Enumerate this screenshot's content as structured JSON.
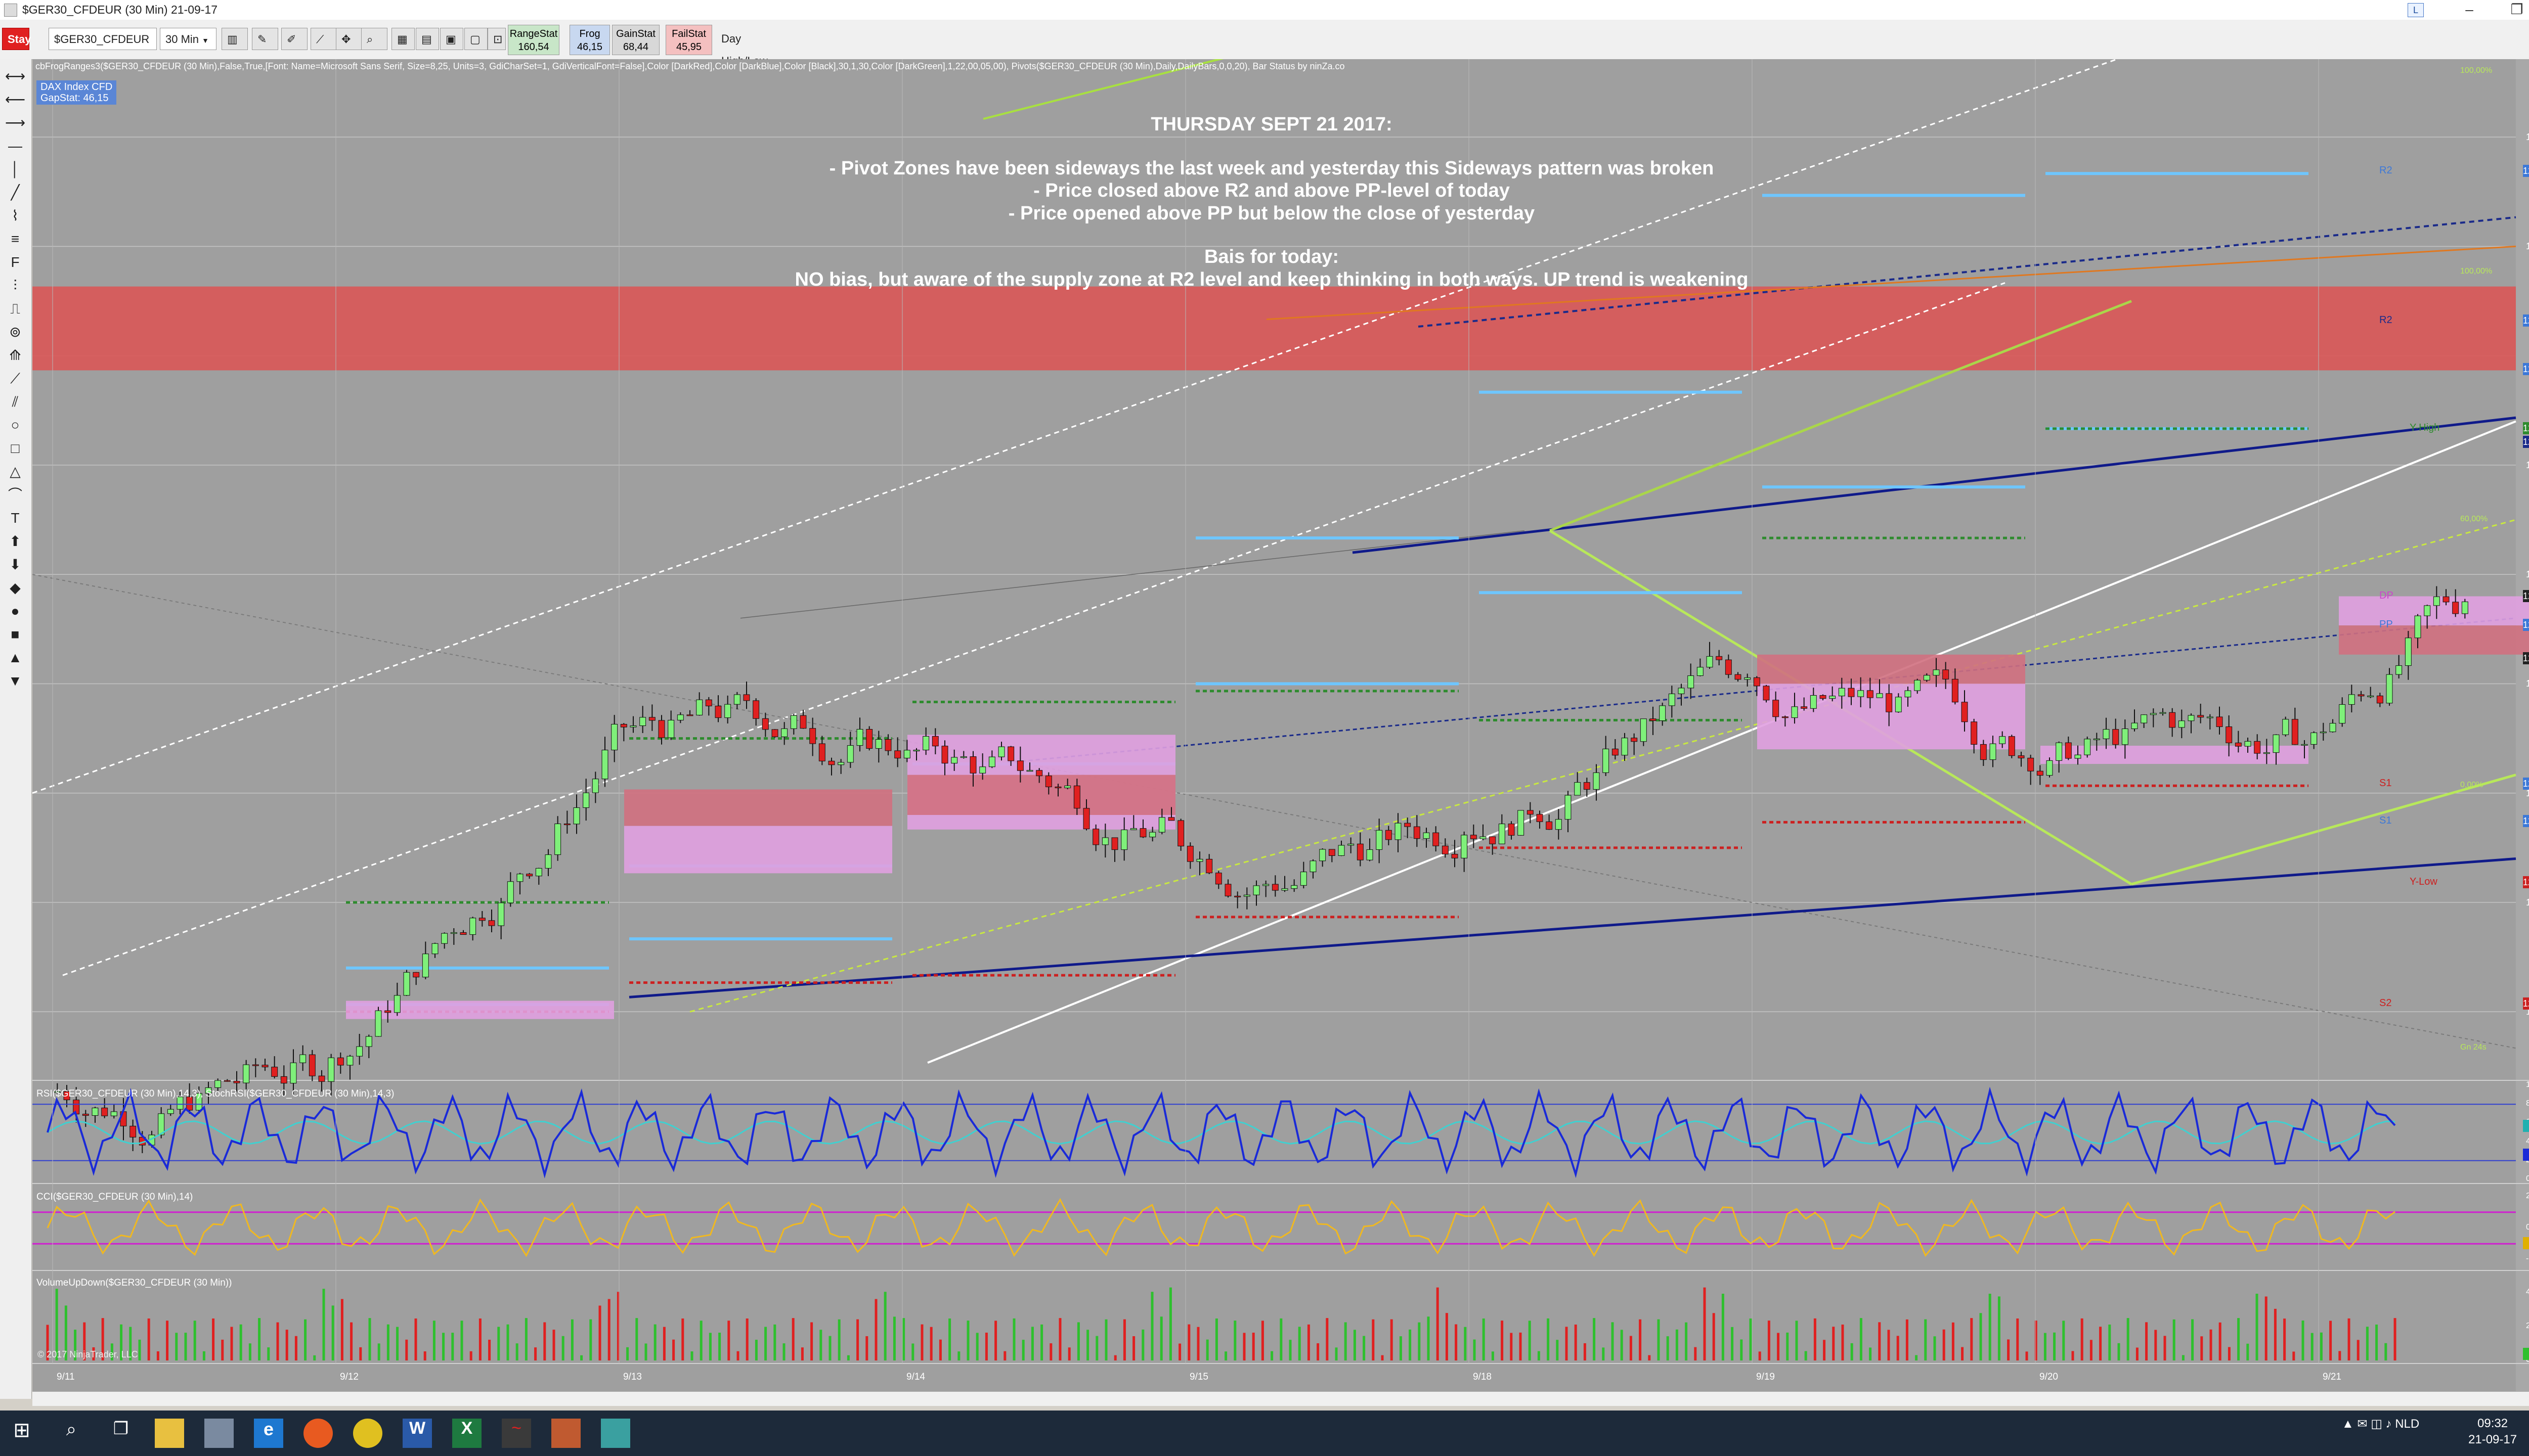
{
  "window": {
    "title": "$GER30_CFDEUR (30 Min)  21-09-17"
  },
  "toolbar": {
    "stay_label": "Stay",
    "instrument": "$GER30_CFDEUR",
    "interval": "30 Min",
    "stats": [
      {
        "name": "RangeStat",
        "value": "160,54",
        "bg": "#c8e6c8"
      },
      {
        "name": "Frog",
        "value": "46,15",
        "bg": "#c8d8f0"
      },
      {
        "name": "GainStat",
        "value": "68,44",
        "bg": "#d8d8d8"
      },
      {
        "name": "FailStat",
        "value": "45,95",
        "bg": "#f4c0c0"
      }
    ],
    "day_hl_label": "Day High/Low"
  },
  "chart": {
    "indicator_line": "cbFrogRanges3($GER30_CFDEUR (30 Min),False,True,[Font: Name=Microsoft Sans Serif, Size=8,25, Units=3, GdiCharSet=1, GdiVerticalFont=False],Color [DarkRed],Color [DarkBlue],Color [Black],30,1,30,Color [DarkGreen],1,22,00,05,00), Pivots($GER30_CFDEUR (30 Min),Daily,DailyBars,0,0,20), Bar Status by ninZa.co",
    "info_title": "DAX Index CFD",
    "info_gap": "GapStat: 46,15",
    "annotations": [
      "THURSDAY SEPT 21 2017:",
      "- Pivot Zones have been sideways the last week and yesterday this Sideways pattern was broken",
      "- Price closed above R2 and above PP-level of today",
      "- Price opened above PP but below the close of yesterday",
      "Bais for today:",
      "NO bias, but aware of the supply zone at R2 level and keep thinking in both ways. UP trend is weakening"
    ],
    "price_axis": [
      "12720,00",
      "12690,00",
      "12630,00",
      "12600,00",
      "12570,00",
      "12540,00",
      "12510,00",
      "12480,00"
    ],
    "price_tags": [
      {
        "text": "12710,72",
        "color": "#3c78d8",
        "price": 12710.72
      },
      {
        "text": "12669,65",
        "color": "#3c78d8",
        "price": 12669.65
      },
      {
        "text": "12656,38",
        "color": "#3c78d8",
        "price": 12656.38
      },
      {
        "text": "12640,06",
        "color": "#2e8b2e",
        "price": 12640.06
      },
      {
        "text": "12636,35",
        "color": "#1a2a8a",
        "price": 12636.35
      },
      {
        "text": "12594,05",
        "color": "#222222",
        "price": 12594.05
      },
      {
        "text": "12586,22",
        "color": "#3c78d8",
        "price": 12586.22
      },
      {
        "text": "12576,96",
        "color": "#222222",
        "price": 12576.96
      },
      {
        "text": "12542,56",
        "color": "#3c78d8",
        "price": 12542.56
      },
      {
        "text": "12532,38",
        "color": "#3c78d8",
        "price": 12532.38
      },
      {
        "text": "12515,55",
        "color": "#cc2020",
        "price": 12515.55
      },
      {
        "text": "12482,25",
        "color": "#cc2020",
        "price": 12482.25
      }
    ],
    "pivot_labels": [
      {
        "text": "R2",
        "price": 12710.72,
        "color": "#3c78d8"
      },
      {
        "text": "R2",
        "price": 12669.65,
        "color": "#1a2a8a"
      },
      {
        "text": "Y-High",
        "price": 12640.06,
        "color": "#2e8b2e"
      },
      {
        "text": "DP",
        "price": 12594.05,
        "color": "#cc44cc"
      },
      {
        "text": "PP",
        "price": 12586.22,
        "color": "#3c78d8"
      },
      {
        "text": "S1",
        "price": 12542.56,
        "color": "#cc2020"
      },
      {
        "text": "S1",
        "price": 12532.38,
        "color": "#3c78d8"
      },
      {
        "text": "Y-Low",
        "price": 12515.55,
        "color": "#cc2020"
      },
      {
        "text": "S2",
        "price": 12482.25,
        "color": "#cc2020"
      }
    ],
    "fib_labels": [
      {
        "text": "100,00%",
        "price": 12738
      },
      {
        "text": "100,00%",
        "price": 12683
      },
      {
        "text": "60,00%",
        "price": 12615
      },
      {
        "text": "0,00%",
        "price": 12542
      },
      {
        "text": "Gn 24s",
        "price": 12470
      }
    ],
    "dates": [
      "9/11",
      "9/12",
      "9/13",
      "9/14",
      "9/15",
      "9/18",
      "9/19",
      "9/20",
      "9/21"
    ],
    "copyright": "© 2017 NinjaTrader, LLC",
    "rsi_label": "RSI($GER30_CFDEUR (30 Min),14,3), StochRSI($GER30_CFDEUR (30 Min),14,3)",
    "rsi_axis": [
      "100",
      "80",
      "60",
      "40",
      "20",
      "0"
    ],
    "rsi_tags": [
      {
        "text": "56,89",
        "color": "#20b0b0"
      },
      {
        "text": "26,29",
        "color": "#1a2ad8"
      }
    ],
    "cci_label": "CCI($GER30_CFDEUR (30 Min),14)",
    "cci_axis": [
      "200",
      "0",
      "-200"
    ],
    "cci_tag": {
      "text": "-96,33",
      "color": "#e0b000"
    },
    "vol_label": "VolumeUpDown($GER30_CFDEUR (30 Min))",
    "vol_axis": [
      "4000",
      "2000",
      "0"
    ],
    "vol_tag": {
      "text": "137",
      "color": "#2ec02e"
    }
  },
  "chart_data": {
    "type": "candlestick",
    "ylim": [
      12462,
      12740
    ],
    "candles_per_day": 30,
    "days": [
      "9/11",
      "9/12",
      "9/13",
      "9/14",
      "9/15",
      "9/18",
      "9/19",
      "9/20",
      "9/21"
    ],
    "key_closes": [
      {
        "day": "9/11",
        "close": 12465
      },
      {
        "day": "9/12",
        "close": 12554
      },
      {
        "day": "9/13",
        "close": 12553
      },
      {
        "day": "9/14",
        "close": 12528
      },
      {
        "day": "9/15",
        "close": 12531
      },
      {
        "day": "9/18",
        "close": 12575
      },
      {
        "day": "9/19",
        "close": 12551
      },
      {
        "day": "9/20",
        "close": 12554
      },
      {
        "day": "9/21",
        "close": 12594
      }
    ],
    "supply_zone": [
      12656,
      12679
    ]
  },
  "taskbar": {
    "lang": "NLD",
    "time": "09:32",
    "date": "21-09-17"
  }
}
